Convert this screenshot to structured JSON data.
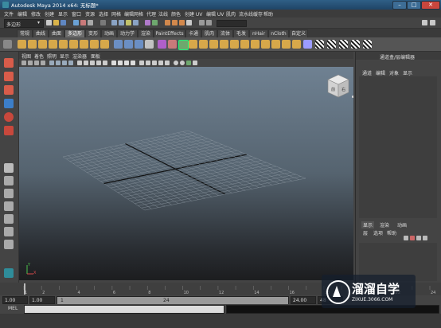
{
  "window": {
    "title": "Autodesk Maya 2014 x64: 无标题*"
  },
  "menu": [
    "文件",
    "编辑",
    "修改",
    "创建",
    "显示",
    "窗口",
    "资源",
    "选择",
    "网格",
    "编辑网格",
    "代理",
    "法线",
    "颜色",
    "创建 UV",
    "编辑 UV",
    "肌肉",
    "流水线缓存",
    "帮助"
  ],
  "mode_selector": {
    "value": "多边形"
  },
  "shelf_tabs": [
    "常规",
    "曲线",
    "曲面",
    "多边形",
    "变形",
    "动画",
    "动力学",
    "渲染",
    "PaintEffects",
    "卡通",
    "肌肉",
    "流体",
    "毛发",
    "nHair",
    "nCloth",
    "自定义"
  ],
  "active_shelf_tab": "多边形",
  "view_menu": [
    "视图",
    "着色",
    "照明",
    "显示",
    "渲染器",
    "面板"
  ],
  "viewcube": {
    "front": "前",
    "right": "右"
  },
  "axis": {
    "y": "Y",
    "x": "X"
  },
  "right_panel": {
    "title": "通道盒/层编辑器",
    "menu": [
      "通道",
      "编辑",
      "对象",
      "显示"
    ],
    "layer_tabs": [
      "显示",
      "渲染",
      "动画"
    ],
    "layer_menu": [
      "层",
      "选项",
      "帮助"
    ]
  },
  "time_ticks": [
    "1",
    "2",
    "4",
    "6",
    "8",
    "10",
    "12",
    "14",
    "16",
    "18",
    "20",
    "22",
    "24"
  ],
  "range": {
    "start": "1.00",
    "inner_start": "1.00",
    "slider_min": "1",
    "slider_max": "24",
    "end": "24.00",
    "inner_end": "48"
  },
  "command": {
    "label": "MEL"
  },
  "watermark": {
    "brand": "溜溜自学",
    "url": "ZIXUE.3066.COM"
  }
}
